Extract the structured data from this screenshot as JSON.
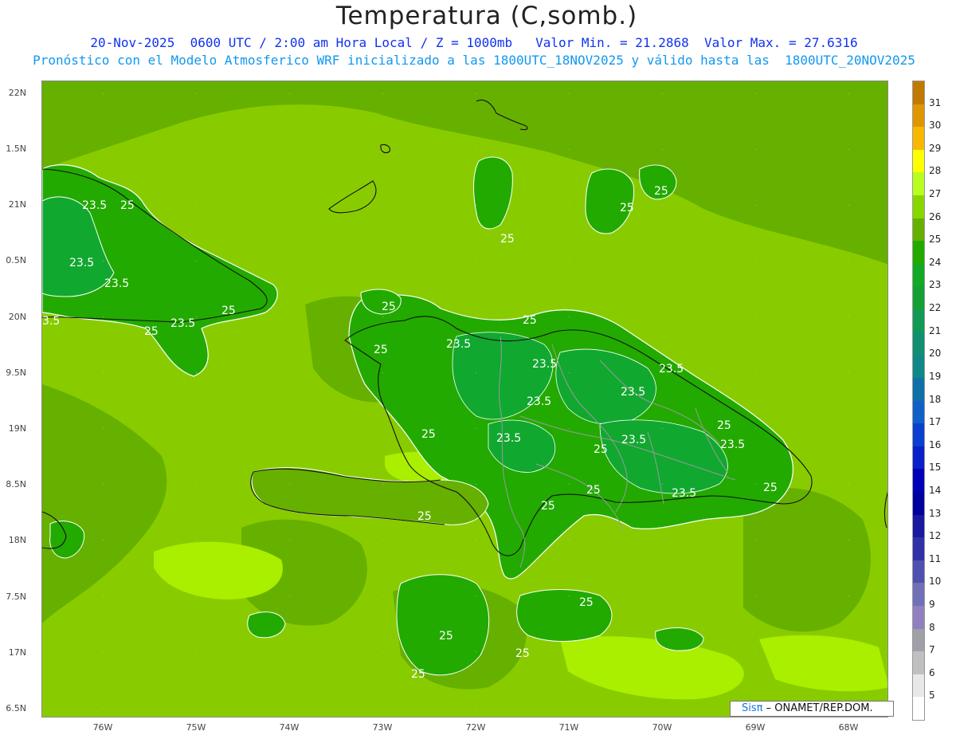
{
  "header": {
    "title": "Temperatura (C,somb.)",
    "line1": "20-Nov-2025  0600 UTC / 2:00 am Hora Local / Z = 1000mb   Valor Min. = 21.2868  Valor Max. = 27.6316",
    "line2": "Pronóstico con el Modelo Atmosferico WRF inicializado a las 1800UTC_18NOV2025 y válido hasta las  1800UTC_20NOV2025"
  },
  "axes": {
    "lat_labels": [
      "22N",
      "1.5N",
      "21N",
      "0.5N",
      "20N",
      "9.5N",
      "19N",
      "8.5N",
      "18N",
      "7.5N",
      "17N",
      "6.5N"
    ],
    "lon_labels": [
      "76W",
      "75W",
      "74W",
      "73W",
      "72W",
      "71W",
      "70W",
      "69W",
      "68W"
    ]
  },
  "colorbar": {
    "labels": [
      "31",
      "30",
      "29",
      "28",
      "27",
      "26",
      "25",
      "24",
      "23",
      "22",
      "21",
      "20",
      "19",
      "18",
      "17",
      "16",
      "15",
      "14",
      "13",
      "12",
      "11",
      "10",
      "9",
      "8",
      "7",
      "6",
      "5"
    ],
    "colors": [
      "#c07a00",
      "#e09600",
      "#f8b800",
      "#ffff00",
      "#b8ff20",
      "#88d800",
      "#66b000",
      "#22aa00",
      "#11aa22",
      "#15a035",
      "#119955",
      "#109070",
      "#108888",
      "#1070a8",
      "#1060c8",
      "#0a40d0",
      "#0a20c8",
      "#0000b8",
      "#0000a0",
      "#1818a0",
      "#3030a8",
      "#5050b0",
      "#7070b8",
      "#9080c0",
      "#a0a0a8",
      "#c0c0c0",
      "#e8e8e8",
      "#ffffff"
    ]
  },
  "contour_labels": {
    "label_25": "25",
    "label_23_5": "23.5",
    "label_3_5": "3.5"
  },
  "credit": {
    "sis": "Sis",
    "pi": "π",
    "rest": "– ONAMET/REP.DOM."
  }
}
